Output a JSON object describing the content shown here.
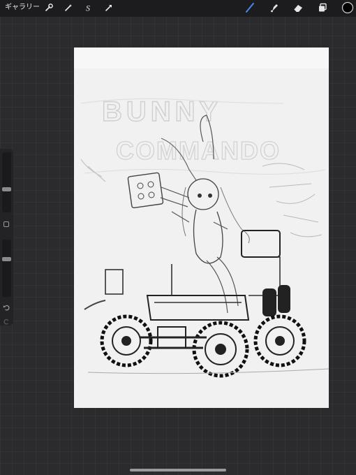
{
  "toolbar": {
    "gallery_label": "ギャラリー",
    "left_tools": [
      {
        "icon": "wrench-icon",
        "name": "actions"
      },
      {
        "icon": "magic-wand-icon",
        "name": "adjustments"
      },
      {
        "icon": "selection-s-icon",
        "name": "selection"
      },
      {
        "icon": "transform-arrow-icon",
        "name": "transform"
      }
    ],
    "right_tools": [
      {
        "icon": "brush-icon",
        "name": "paint",
        "active": true
      },
      {
        "icon": "smudge-icon",
        "name": "smudge"
      },
      {
        "icon": "eraser-icon",
        "name": "eraser"
      },
      {
        "icon": "layers-icon",
        "name": "layers"
      },
      {
        "icon": "color-swatch-icon",
        "name": "color"
      }
    ],
    "active_color": "#4a86e8",
    "current_color": "#000000"
  },
  "sidebar": {
    "brush_size_level": 0.6,
    "opacity_level": 0.35
  },
  "canvas": {
    "background": "#f7f7f7",
    "sketch_text_line1": "BUNNY",
    "sketch_text_line2": "COMMANDO"
  },
  "colors": {
    "app_bg": "#2b2b2d",
    "topbar_bg": "#1c1c1e",
    "sidebar_bg": "#232325"
  }
}
